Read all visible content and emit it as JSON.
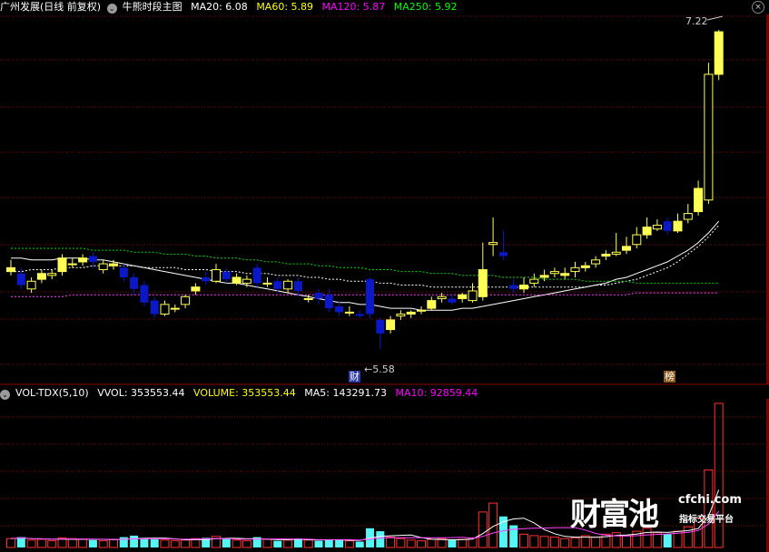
{
  "price_panel": {
    "stock_name": "广州发展(日线 前复权)",
    "indicator_name": "牛熊时段主图",
    "ma20": {
      "label": "MA20: 6.08",
      "color": "#ffffff"
    },
    "ma60": {
      "label": "MA60: 5.89",
      "color": "#ffff00"
    },
    "ma120": {
      "label": "MA120: 5.87",
      "color": "#ff00ff"
    },
    "ma250": {
      "label": "MA250: 5.92",
      "color": "#00ff00"
    },
    "high_label": "7.22",
    "low_label": "←5.58",
    "event_tag_1": "财",
    "event_tag_2": "榜",
    "close_icon": "close-icon"
  },
  "volume_panel": {
    "indicator": "VOL-TDX(5,10)",
    "vvol": "VVOL: 353553.44",
    "volume": "VOLUME: 353553.44",
    "ma5": "MA5: 143291.73",
    "ma10": "MA10: 92859.44",
    "colors": {
      "vvol": "#ffffff",
      "volume": "#ffff00",
      "ma5": "#ffffff",
      "ma10": "#ff00ff"
    }
  },
  "watermark": {
    "logo": "财富池",
    "url": "cfchi.com",
    "slogan": "指标交易平台"
  },
  "colors": {
    "up": "#ffff55",
    "down": "#0a18c8",
    "vol_up": "#ff3030",
    "vol_down": "#55f5f5",
    "grid": "#8b0000"
  },
  "chart_data": {
    "type": "candlestick",
    "price_range": [
      5.5,
      7.3
    ],
    "candles": [
      [
        5.98,
        6.0,
        6.04,
        5.96
      ],
      [
        5.97,
        5.91,
        6.0,
        5.89
      ],
      [
        5.89,
        5.93,
        5.95,
        5.87
      ],
      [
        5.94,
        5.97,
        5.99,
        5.92
      ],
      [
        5.96,
        5.97,
        5.99,
        5.94
      ],
      [
        5.98,
        6.05,
        6.07,
        5.96
      ],
      [
        6.02,
        6.02,
        6.05,
        6.0
      ],
      [
        6.03,
        6.05,
        6.07,
        6.01
      ],
      [
        6.06,
        6.03,
        6.08,
        6.0
      ],
      [
        5.99,
        6.02,
        6.04,
        5.97
      ],
      [
        6.01,
        6.02,
        6.04,
        5.99
      ],
      [
        6.0,
        5.95,
        6.02,
        5.93
      ],
      [
        5.95,
        5.89,
        5.97,
        5.86
      ],
      [
        5.91,
        5.82,
        5.93,
        5.8
      ],
      [
        5.83,
        5.76,
        5.85,
        5.74
      ],
      [
        5.76,
        5.81,
        5.83,
        5.75
      ],
      [
        5.79,
        5.79,
        5.81,
        5.77
      ],
      [
        5.81,
        5.85,
        5.86,
        5.79
      ],
      [
        5.88,
        5.9,
        5.92,
        5.86
      ],
      [
        5.95,
        5.93,
        5.98,
        5.91
      ],
      [
        5.93,
        5.99,
        6.02,
        5.92
      ],
      [
        5.98,
        5.94,
        6.0,
        5.92
      ],
      [
        5.92,
        5.95,
        5.97,
        5.91
      ],
      [
        5.92,
        5.94,
        5.96,
        5.9
      ],
      [
        6.0,
        5.92,
        6.02,
        5.9
      ],
      [
        5.92,
        5.92,
        5.95,
        5.9
      ],
      [
        5.93,
        5.89,
        5.95,
        5.87
      ],
      [
        5.89,
        5.93,
        5.94,
        5.87
      ],
      [
        5.93,
        5.88,
        5.95,
        5.85
      ],
      [
        5.84,
        5.84,
        5.86,
        5.82
      ],
      [
        5.87,
        5.84,
        5.89,
        5.81
      ],
      [
        5.86,
        5.79,
        5.89,
        5.77
      ],
      [
        5.8,
        5.77,
        5.83,
        5.75
      ],
      [
        5.77,
        5.77,
        5.8,
        5.75
      ],
      [
        5.76,
        5.75,
        5.78,
        5.74
      ],
      [
        5.94,
        5.76,
        5.95,
        5.74
      ],
      [
        5.73,
        5.66,
        5.74,
        5.58
      ],
      [
        5.68,
        5.73,
        5.75,
        5.66
      ],
      [
        5.75,
        5.76,
        5.78,
        5.73
      ],
      [
        5.76,
        5.77,
        5.78,
        5.74
      ],
      [
        5.78,
        5.78,
        5.8,
        5.76
      ],
      [
        5.79,
        5.83,
        5.85,
        5.78
      ],
      [
        5.84,
        5.85,
        5.87,
        5.82
      ],
      [
        5.84,
        5.82,
        5.86,
        5.81
      ],
      [
        5.84,
        5.86,
        5.87,
        5.82
      ],
      [
        5.83,
        5.88,
        5.92,
        5.82
      ],
      [
        5.85,
        5.99,
        6.13,
        5.83
      ],
      [
        6.12,
        6.13,
        6.26,
        6.06
      ],
      [
        6.08,
        6.06,
        6.19,
        6.04
      ],
      [
        5.91,
        5.89,
        5.94,
        5.87
      ],
      [
        5.89,
        5.91,
        5.95,
        5.87
      ],
      [
        5.92,
        5.94,
        5.97,
        5.9
      ],
      [
        5.95,
        5.96,
        5.99,
        5.93
      ],
      [
        5.97,
        5.98,
        6.0,
        5.95
      ],
      [
        5.96,
        5.97,
        6.0,
        5.94
      ],
      [
        5.98,
        6.0,
        6.03,
        5.95
      ],
      [
        6.0,
        6.01,
        6.03,
        5.98
      ],
      [
        6.02,
        6.04,
        6.06,
        6.0
      ],
      [
        6.06,
        6.07,
        6.09,
        6.04
      ],
      [
        6.07,
        6.08,
        6.18,
        6.06
      ],
      [
        6.09,
        6.11,
        6.16,
        6.07
      ],
      [
        6.12,
        6.17,
        6.21,
        6.1
      ],
      [
        6.17,
        6.21,
        6.26,
        6.15
      ],
      [
        6.2,
        6.22,
        6.25,
        6.19
      ],
      [
        6.24,
        6.19,
        6.26,
        6.17
      ],
      [
        6.19,
        6.24,
        6.28,
        6.18
      ],
      [
        6.25,
        6.28,
        6.33,
        6.23
      ],
      [
        6.29,
        6.41,
        6.45,
        6.27
      ],
      [
        6.35,
        7.0,
        7.06,
        6.33
      ],
      [
        7.0,
        7.22,
        7.23,
        6.97
      ]
    ],
    "ma_lines": [
      {
        "name": "MA20",
        "color": "#ffffff",
        "values_from_index": 0,
        "values": [
          6.05,
          6.05,
          6.04,
          6.04,
          6.04,
          6.05,
          6.05,
          6.05,
          6.04,
          6.04,
          6.03,
          6.02,
          6.01,
          6.0,
          5.99,
          5.98,
          5.97,
          5.96,
          5.95,
          5.94,
          5.93,
          5.92,
          5.92,
          5.91,
          5.9,
          5.89,
          5.88,
          5.87,
          5.86,
          5.85,
          5.84,
          5.83,
          5.82,
          5.82,
          5.81,
          5.81,
          5.8,
          5.79,
          5.79,
          5.79,
          5.78,
          5.78,
          5.78,
          5.78,
          5.79,
          5.79,
          5.8,
          5.81,
          5.82,
          5.83,
          5.84,
          5.85,
          5.86,
          5.87,
          5.88,
          5.89,
          5.9,
          5.91,
          5.92,
          5.94,
          5.95,
          5.97,
          5.99,
          6.01,
          6.03,
          6.06,
          6.09,
          6.13,
          6.18,
          6.24
        ]
      },
      {
        "name": "MA60",
        "color": "#ffffff",
        "dashed": true,
        "values": [
          5.98,
          5.98,
          5.99,
          5.99,
          5.99,
          6.0,
          6.0,
          6.0,
          6.01,
          6.01,
          6.01,
          6.01,
          6.01,
          6.0,
          6.0,
          6.0,
          6.0,
          5.99,
          5.99,
          5.99,
          5.98,
          5.98,
          5.98,
          5.97,
          5.97,
          5.97,
          5.96,
          5.96,
          5.96,
          5.95,
          5.95,
          5.94,
          5.94,
          5.93,
          5.93,
          5.93,
          5.92,
          5.92,
          5.91,
          5.91,
          5.91,
          5.9,
          5.9,
          5.9,
          5.9,
          5.9,
          5.9,
          5.9,
          5.9,
          5.9,
          5.9,
          5.9,
          5.9,
          5.9,
          5.9,
          5.9,
          5.9,
          5.91,
          5.91,
          5.92,
          5.93,
          5.94,
          5.96,
          5.98,
          6.0,
          6.03,
          6.07,
          6.11,
          6.16,
          6.22
        ]
      },
      {
        "name": "MA120",
        "color": "#ff44ff",
        "dashed": true,
        "values": [
          5.85,
          5.85,
          5.85,
          5.85,
          5.85,
          5.85,
          5.86,
          5.86,
          5.86,
          5.86,
          5.86,
          5.86,
          5.86,
          5.86,
          5.86,
          5.86,
          5.86,
          5.86,
          5.86,
          5.86,
          5.86,
          5.86,
          5.86,
          5.86,
          5.86,
          5.86,
          5.86,
          5.86,
          5.86,
          5.86,
          5.86,
          5.86,
          5.86,
          5.86,
          5.86,
          5.86,
          5.86,
          5.86,
          5.86,
          5.86,
          5.86,
          5.86,
          5.86,
          5.86,
          5.86,
          5.86,
          5.86,
          5.86,
          5.86,
          5.86,
          5.86,
          5.86,
          5.86,
          5.86,
          5.86,
          5.86,
          5.86,
          5.86,
          5.86,
          5.86,
          5.86,
          5.87,
          5.87,
          5.87,
          5.87,
          5.87,
          5.87,
          5.87,
          5.87,
          5.87
        ]
      },
      {
        "name": "MA250",
        "color": "#00dd00",
        "dashed": true,
        "values": [
          6.1,
          6.1,
          6.1,
          6.1,
          6.1,
          6.1,
          6.1,
          6.1,
          6.09,
          6.09,
          6.09,
          6.09,
          6.08,
          6.08,
          6.08,
          6.07,
          6.07,
          6.07,
          6.06,
          6.06,
          6.05,
          6.05,
          6.05,
          6.04,
          6.04,
          6.03,
          6.03,
          6.02,
          6.02,
          6.02,
          6.01,
          6.01,
          6.0,
          6.0,
          6.0,
          5.99,
          5.99,
          5.99,
          5.98,
          5.98,
          5.98,
          5.97,
          5.97,
          5.97,
          5.96,
          5.96,
          5.96,
          5.96,
          5.95,
          5.95,
          5.95,
          5.95,
          5.94,
          5.94,
          5.94,
          5.94,
          5.93,
          5.93,
          5.93,
          5.93,
          5.93,
          5.92,
          5.92,
          5.92,
          5.92,
          5.92,
          5.92,
          5.92,
          5.92,
          5.92
        ]
      }
    ],
    "volumes": [
      12,
      14,
      10,
      11,
      9,
      13,
      12,
      11,
      10,
      9,
      11,
      14,
      16,
      12,
      11,
      10,
      9,
      10,
      12,
      13,
      15,
      12,
      10,
      9,
      14,
      11,
      9,
      10,
      12,
      10,
      9,
      11,
      10,
      9,
      8,
      26,
      22,
      14,
      12,
      10,
      9,
      11,
      12,
      10,
      11,
      13,
      48,
      60,
      42,
      30,
      18,
      16,
      15,
      14,
      12,
      13,
      16,
      14,
      18,
      20,
      16,
      22,
      26,
      20,
      18,
      22,
      28,
      40,
      105,
      195
    ]
  }
}
